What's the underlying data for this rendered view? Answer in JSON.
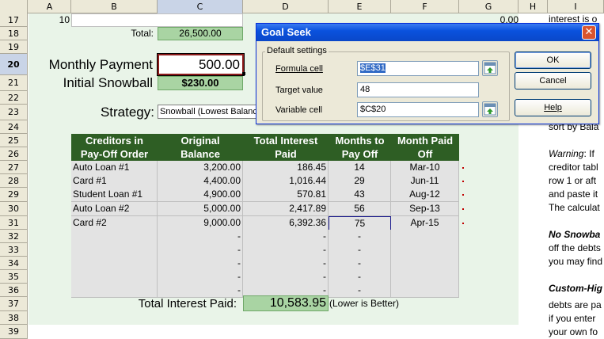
{
  "columns": [
    "A",
    "B",
    "C",
    "D",
    "E",
    "F",
    "G",
    "H",
    "I"
  ],
  "rows": [
    "17",
    "18",
    "19",
    "20",
    "21",
    "22",
    "23",
    "24",
    "25",
    "26",
    "27",
    "28",
    "29",
    "30",
    "31",
    "32",
    "33",
    "34",
    "35",
    "36",
    "37",
    "38",
    "39"
  ],
  "cells": {
    "a17": "10",
    "b18": "Total:",
    "c18": "26,500.00",
    "g17": "0.00",
    "monthly_payment_label": "Monthly Payment",
    "monthly_payment_value": "500.00",
    "initial_snowball_label": "Initial Snowball",
    "initial_snowball_value": "$230.00",
    "strategy_label": "Strategy:",
    "strategy_value": "Snowball (Lowest Balance",
    "total_interest_label": "Total Interest Paid:",
    "total_interest_value": "10,583.95",
    "total_interest_note": "(Lower is Better)"
  },
  "table": {
    "headers": [
      [
        "Creditors in",
        "Pay-Off Order"
      ],
      [
        "Original",
        "Balance"
      ],
      [
        "Total Interest",
        "Paid"
      ],
      [
        "Months to",
        "Pay Off"
      ],
      [
        "Month Paid",
        "Off"
      ]
    ],
    "rows": [
      [
        "Auto Loan #1",
        "3,200.00",
        "186.45",
        "14",
        "Mar-10"
      ],
      [
        "Card #1",
        "4,400.00",
        "1,016.44",
        "29",
        "Jun-11"
      ],
      [
        "Student Loan #1",
        "4,900.00",
        "570.81",
        "43",
        "Aug-12"
      ],
      [
        "Auto Loan #2",
        "5,000.00",
        "2,417.89",
        "56",
        "Sep-13"
      ],
      [
        "Card #2",
        "9,000.00",
        "6,392.36",
        "75",
        "Apr-15"
      ],
      [
        "",
        "-",
        "-",
        "-",
        ""
      ],
      [
        "",
        "-",
        "-",
        "-",
        ""
      ],
      [
        "",
        "-",
        "-",
        "-",
        ""
      ],
      [
        "",
        "-",
        "-",
        "-",
        ""
      ],
      [
        "",
        "-",
        "-",
        "-",
        ""
      ]
    ]
  },
  "right_text": {
    "line0": "interest is o",
    "line1": "sort by Bala",
    "line2_em": "Warning",
    "line2_rest": ": If",
    "line3": "creditor tabl",
    "line4": "row 1 or aft",
    "line5": "and paste it",
    "line6": "The calculat",
    "line7": "No Snowba",
    "line8": "off the debts",
    "line9": "you may find",
    "line10": "Custom-Hig",
    "line11": "debts are pa",
    "line12": "if you enter",
    "line13": "your own fo"
  },
  "dialog": {
    "title": "Goal Seek",
    "group_label": "Default settings",
    "formula_label": "Formula cell",
    "formula_value": "$E$31",
    "target_label": "Target value",
    "target_value": "48",
    "variable_label": "Variable cell",
    "variable_value": "$C$20",
    "ok_label": "OK",
    "cancel_label": "Cancel",
    "help_label": "Help",
    "close_glyph": "✕"
  }
}
